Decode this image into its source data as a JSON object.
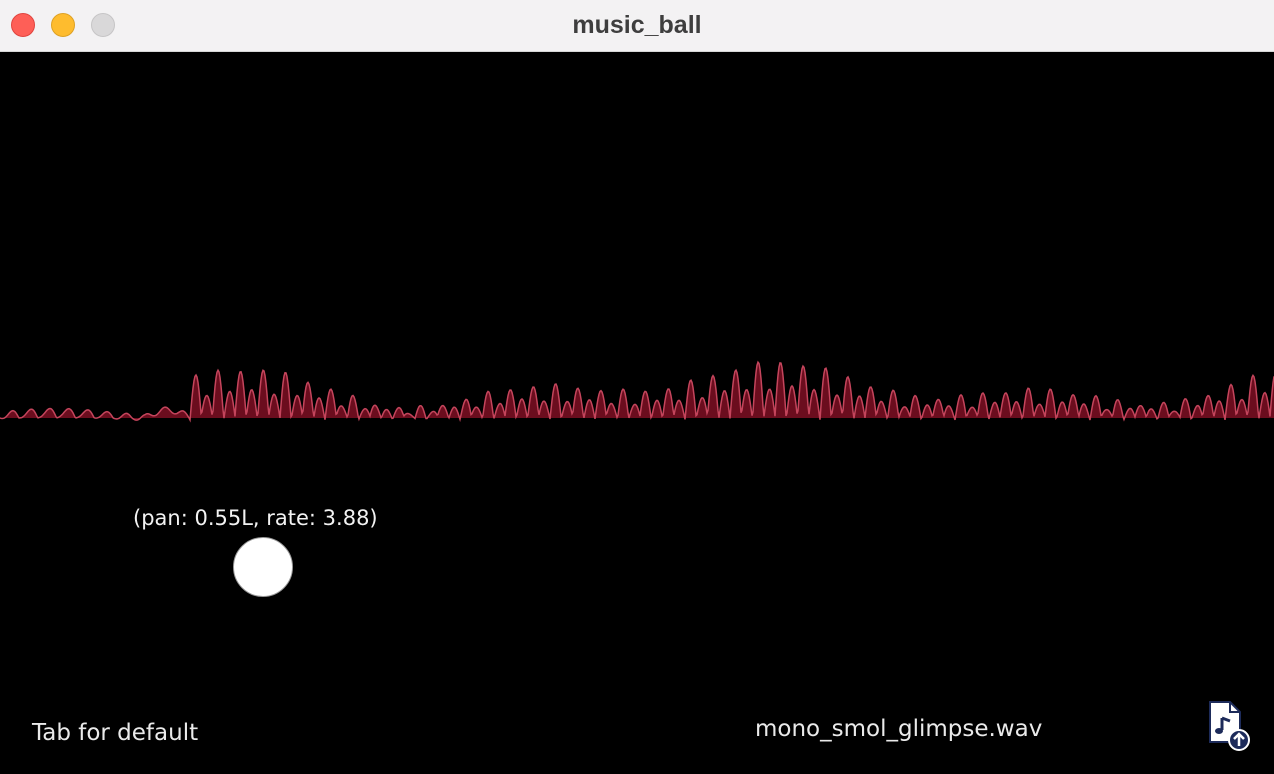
{
  "window": {
    "title": "music_ball"
  },
  "ball": {
    "label": "(pan: 0.55L, rate: 3.88)",
    "pan": "0.55L",
    "rate": 3.88
  },
  "footer": {
    "hint": "Tab for default",
    "filename": "mono_smol_glimpse.wav"
  },
  "icons": {
    "file": "music-file-upload-icon"
  },
  "colors": {
    "background": "#000000",
    "waveform_fill": "#6b0d1e",
    "waveform_stroke": "#c4455c",
    "ball": "#ffffff"
  }
}
